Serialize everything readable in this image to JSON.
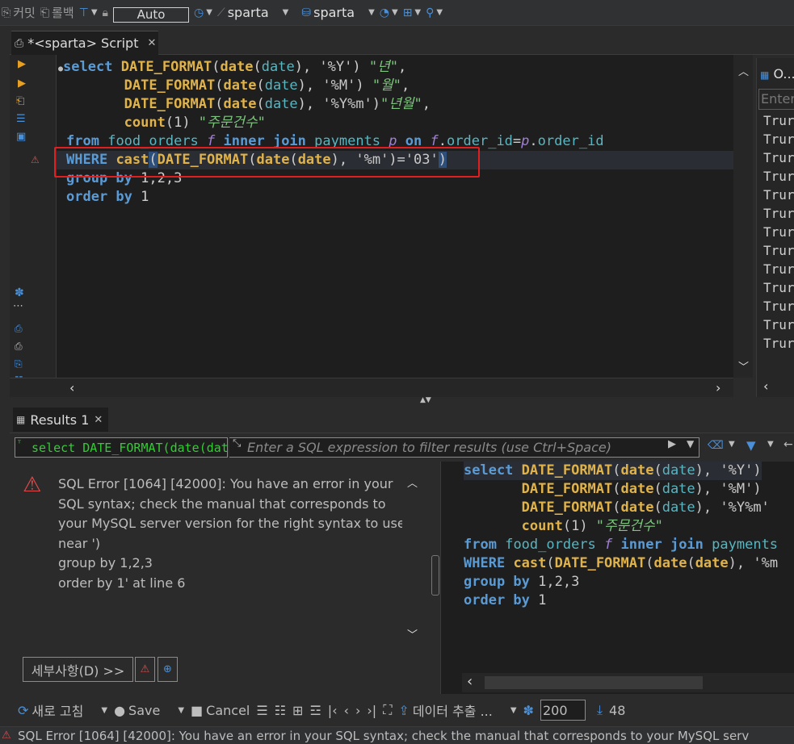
{
  "toolbar": {
    "commit_label": "커밋",
    "rollback_label": "롤백",
    "tx_mode_label": "Auto",
    "datasource_label": "sparta",
    "schema_label": "sparta"
  },
  "editor": {
    "tab_title": "*<sparta> Script",
    "lines": [
      "select DATE_FORMAT(date(date), '%Y') \"년\",",
      "       DATE_FORMAT(date(date), '%M') \"월\",",
      "       DATE_FORMAT(date(date), '%Y%m')\"년월\",",
      "       count(1) \"주문건수\"",
      "from food_orders f inner join payments p on f.order_id=p.order_id",
      "WHERE cast(DATE_FORMAT(date(date), '%m')='03')",
      "group by 1,2,3",
      "order by 1"
    ]
  },
  "outline": {
    "title": "O...",
    "placeholder": "Enter",
    "rows": [
      "Trur",
      "Trur",
      "Trur",
      "Trur",
      "Trur",
      "Trur",
      "Trur",
      "Trur",
      "Trur",
      "Trur",
      "Trur",
      "Trur",
      "Trur"
    ]
  },
  "results": {
    "tab_label": "Results 1",
    "query_field": "select DATE_FORMAT(date(date",
    "filter_placeholder": "Enter a SQL expression to filter results (use Ctrl+Space)",
    "error_message": "SQL Error [1064] [42000]: You have an error in your SQL syntax; check the manual that corresponds to your MySQL server version for the right syntax to use near ')\ngroup by 1,2,3\norder by 1' at line 6",
    "details_button": "세부사항(D) >>",
    "preview_lines": [
      "select DATE_FORMAT(date(date), '%Y')",
      "       DATE_FORMAT(date(date), '%M')",
      "       DATE_FORMAT(date(date), '%Y%m'",
      "       count(1) \"주문건수\"",
      "from food_orders f inner join payments",
      "WHERE cast(DATE_FORMAT(date(date), '%m",
      "group by 1,2,3",
      "order by 1"
    ]
  },
  "bottom_bar": {
    "refresh_label": "새로 고침",
    "save_label": "Save",
    "cancel_label": "Cancel",
    "export_label": "데이터 추출 ...",
    "fetch_size": "200",
    "row_count": "48"
  },
  "status": {
    "message": "SQL Error [1064] [42000]: You have an error in your SQL syntax; check the manual that corresponds to your MySQL serv"
  }
}
